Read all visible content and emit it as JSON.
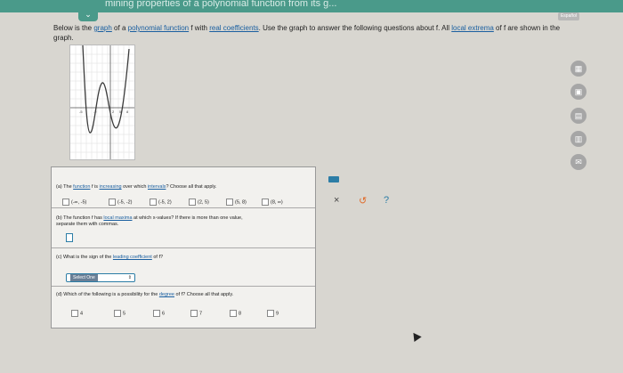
{
  "header": {
    "title": "mining properties of a polynomial function from its g..."
  },
  "collapse_icon": "chevron-down-icon",
  "top_right_button": "Español",
  "intro": {
    "p1": "Below is the ",
    "link_graph": "graph",
    "p2": " of a ",
    "link_poly": "polynomial function",
    "p3": " f with ",
    "link_real": "real coefficients",
    "p4": ". Use the graph to answer the following questions about f. All ",
    "link_extrema": "local extrema",
    "p5": " of f are shown in the graph."
  },
  "graph": {
    "x_ticks": [
      "-5",
      "-2",
      "2",
      "5",
      "8"
    ],
    "curve_color": "#3a3a3a"
  },
  "questions": {
    "a": {
      "prefix": "(a) The ",
      "link1": "function",
      "mid1": " f is ",
      "link2": "increasing",
      "mid2": " over which ",
      "link3": "intervals",
      "suffix": "? Choose all that apply.",
      "options": [
        "(-∞, -5)",
        "(-5, -2)",
        "(-5, 2)",
        "(2, 5)",
        "(5, 8)",
        "(8, ∞)"
      ]
    },
    "b": {
      "prefix": "(b) The function f has ",
      "link": "local maxima",
      "suffix": " at which x-values? If there is more than one value,",
      "line2": "separate them with commas."
    },
    "c": {
      "prefix": "(c) What is the sign of the ",
      "link": "leading coefficient",
      "suffix": " of f?",
      "select_label": "Select One",
      "select_arrow": "⇕"
    },
    "d": {
      "prefix": "(d) Which of the following is a possibility for the ",
      "link": "degree",
      "suffix": " of f? Choose all that apply.",
      "options": [
        "4",
        "5",
        "6",
        "7",
        "8",
        "9"
      ]
    }
  },
  "tools": {
    "clear": "×",
    "undo": "↺",
    "help": "?"
  },
  "side_icons": [
    "calculator-icon",
    "equation-editor-icon",
    "data-table-icon",
    "calendar-icon",
    "mail-icon"
  ],
  "colors": {
    "accent": "#4a9a8a",
    "link": "#1a5fa0",
    "input_border": "#2c7da6",
    "undo": "#e06b2a",
    "help": "#2c7da6"
  }
}
